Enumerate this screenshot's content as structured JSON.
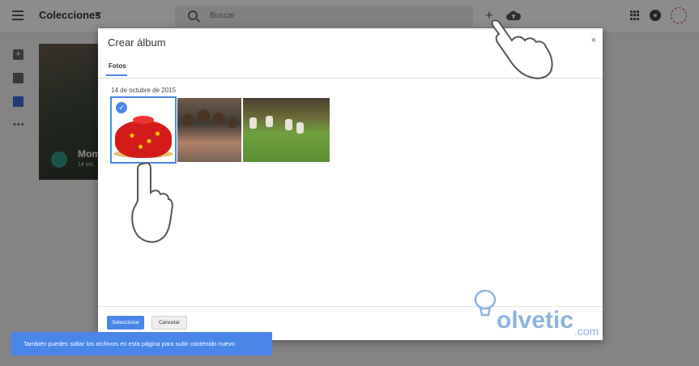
{
  "topbar": {
    "title": "Colecciones",
    "search_placeholder": "Buscar"
  },
  "album_card": {
    "title": "Mom",
    "date": "14 oct."
  },
  "dialog": {
    "title": "Crear álbum",
    "close": "×",
    "tab": "Fotos",
    "date_group": "14 de octubre de 2015",
    "select_button": "Seleccionar",
    "cancel_button": "Cancelar"
  },
  "toast": {
    "message": "También puedes soltar los archivos en esta página para subir contenido nuevo"
  },
  "watermark": {
    "text": "olvetic",
    "suffix": ".com"
  },
  "colors": {
    "accent": "#4a86e8",
    "overlay": "rgba(0,0,0,0.45)"
  }
}
